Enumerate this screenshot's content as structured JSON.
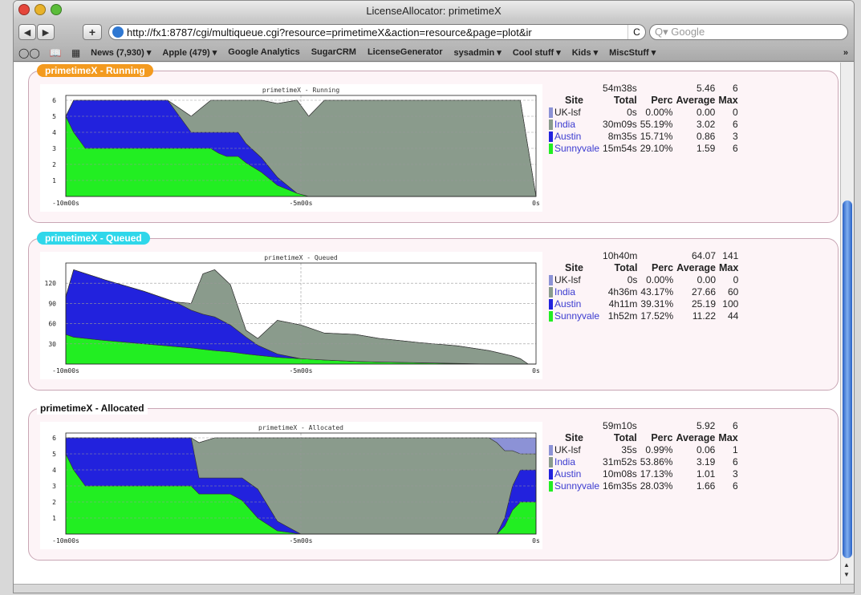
{
  "window": {
    "title": "LicenseAllocator: primetimeX"
  },
  "toolbar": {
    "back": "◀",
    "forward": "▶",
    "add": "+",
    "url": "http://fx1:8787/cgi/multiqueue.cgi?resource=primetimeX&action=resource&page=plot&ir",
    "reload": "C",
    "search_placeholder": "Q▾ Google"
  },
  "bookmarks": [
    {
      "label": "News (7,930) ▾"
    },
    {
      "label": "Apple (479) ▾"
    },
    {
      "label": "Google Analytics"
    },
    {
      "label": "SugarCRM"
    },
    {
      "label": "LicenseGenerator"
    },
    {
      "label": "sysadmin ▾"
    },
    {
      "label": "Cool stuff ▾"
    },
    {
      "label": "Kids ▾"
    },
    {
      "label": "MiscStuff ▾"
    }
  ],
  "bookmarks_overflow": "»",
  "colors": {
    "uk": "#8c92d6",
    "india": "#8a9b8c",
    "austin": "#2222dd",
    "sunnyvale": "#22ee22",
    "running": "#f39a1f",
    "queued": "#2fd7ea"
  },
  "stat_headers": {
    "site": "Site",
    "total": "Total",
    "perc": "Perc",
    "average": "Average",
    "max": "Max"
  },
  "sections": [
    {
      "legend": "primetimeX - Running",
      "summary": {
        "total": "54m38s",
        "average": "5.46",
        "max": "6"
      },
      "rows": [
        {
          "site": "UK-lsf",
          "total": "0s",
          "perc": "0.00%",
          "average": "0.00",
          "max": "0"
        },
        {
          "site": "India",
          "total": "30m09s",
          "perc": "55.19%",
          "average": "3.02",
          "max": "6"
        },
        {
          "site": "Austin",
          "total": "8m35s",
          "perc": "15.71%",
          "average": "0.86",
          "max": "3"
        },
        {
          "site": "Sunnyvale",
          "total": "15m54s",
          "perc": "29.10%",
          "average": "1.59",
          "max": "6"
        }
      ]
    },
    {
      "legend": "primetimeX - Queued",
      "summary": {
        "total": "10h40m",
        "average": "64.07",
        "max": "141"
      },
      "rows": [
        {
          "site": "UK-lsf",
          "total": "0s",
          "perc": "0.00%",
          "average": "0.00",
          "max": "0"
        },
        {
          "site": "India",
          "total": "4h36m",
          "perc": "43.17%",
          "average": "27.66",
          "max": "60"
        },
        {
          "site": "Austin",
          "total": "4h11m",
          "perc": "39.31%",
          "average": "25.19",
          "max": "100"
        },
        {
          "site": "Sunnyvale",
          "total": "1h52m",
          "perc": "17.52%",
          "average": "11.22",
          "max": "44"
        }
      ]
    },
    {
      "legend": "primetimeX - Allocated",
      "summary": {
        "total": "59m10s",
        "average": "5.92",
        "max": "6"
      },
      "rows": [
        {
          "site": "UK-lsf",
          "total": "35s",
          "perc": "0.99%",
          "average": "0.06",
          "max": "1"
        },
        {
          "site": "India",
          "total": "31m52s",
          "perc": "53.86%",
          "average": "3.19",
          "max": "6"
        },
        {
          "site": "Austin",
          "total": "10m08s",
          "perc": "17.13%",
          "average": "1.01",
          "max": "3"
        },
        {
          "site": "Sunnyvale",
          "total": "16m35s",
          "perc": "28.03%",
          "average": "1.66",
          "max": "6"
        }
      ]
    }
  ],
  "chart_data": [
    {
      "type": "area",
      "title": "primetimeX - Running",
      "x": [
        -600,
        -590,
        -575,
        -545,
        -525,
        -500,
        -470,
        -440,
        -415,
        -405,
        -395,
        -380,
        -370,
        -350,
        -330,
        -305,
        -290,
        -270,
        -250,
        -230,
        -200,
        -150,
        -100,
        -70,
        -50,
        -40,
        -30,
        -20,
        -10,
        0
      ],
      "xticks": [
        "-10m00s",
        "-5m00s",
        "0s"
      ],
      "yticks": [
        1,
        2,
        3,
        4,
        5,
        6
      ],
      "ylim": [
        0,
        6.3
      ],
      "series": [
        {
          "name": "Sunnyvale",
          "values": [
            5,
            4,
            3,
            3,
            3,
            3,
            3,
            3,
            3,
            2.7,
            2.5,
            2.5,
            2.1,
            1.5,
            0.7,
            0.2,
            0,
            0,
            0,
            0,
            0,
            0,
            0,
            0,
            0,
            0,
            0,
            0,
            0,
            0
          ]
        },
        {
          "name": "Austin",
          "values": [
            0,
            2,
            3,
            3,
            3,
            3,
            3,
            1,
            1,
            1.3,
            1.5,
            1.5,
            1.2,
            0.9,
            0.5,
            0,
            0,
            0,
            0,
            0,
            0,
            0,
            0,
            0,
            0,
            0,
            0,
            0,
            0,
            0
          ]
        },
        {
          "name": "India",
          "values": [
            0,
            0,
            0,
            0,
            0,
            0,
            0,
            1,
            2,
            2,
            2,
            2,
            2.7,
            3.6,
            4.6,
            5.8,
            5,
            6,
            6,
            6,
            6,
            6,
            6,
            6,
            6,
            6,
            6,
            6,
            3,
            0
          ]
        },
        {
          "name": "UK-lsf",
          "values": [
            0,
            0,
            0,
            0,
            0,
            0,
            0,
            0,
            0,
            0,
            0,
            0,
            0,
            0,
            0,
            0,
            0,
            0,
            0,
            0,
            0,
            0,
            0,
            0,
            0,
            0,
            0,
            0,
            0,
            0
          ]
        }
      ]
    },
    {
      "type": "area",
      "title": "primetimeX - Queued",
      "x": [
        -600,
        -590,
        -550,
        -500,
        -460,
        -440,
        -425,
        -410,
        -390,
        -370,
        -355,
        -330,
        -300,
        -270,
        -230,
        -200,
        -150,
        -100,
        -60,
        -30,
        -20,
        -10,
        0
      ],
      "xticks": [
        "-10m00s",
        "-5m00s",
        "0s"
      ],
      "yticks": [
        30,
        60,
        90,
        120
      ],
      "ylim": [
        0,
        150
      ],
      "series": [
        {
          "name": "Sunnyvale",
          "values": [
            44,
            40,
            35,
            30,
            26,
            24,
            22,
            20,
            18,
            15,
            13,
            10,
            8,
            6,
            4,
            3,
            2,
            1,
            0,
            0,
            0,
            0,
            0
          ]
        },
        {
          "name": "Austin",
          "values": [
            56,
            100,
            90,
            78,
            66,
            56,
            52,
            50,
            40,
            25,
            15,
            5,
            0,
            0,
            0,
            0,
            0,
            0,
            0,
            0,
            0,
            0,
            0
          ]
        },
        {
          "name": "India",
          "values": [
            0,
            0,
            0,
            0,
            0,
            10,
            60,
            70,
            60,
            10,
            10,
            50,
            50,
            40,
            40,
            35,
            30,
            26,
            20,
            12,
            8,
            0,
            0
          ]
        },
        {
          "name": "UK-lsf",
          "values": [
            0,
            0,
            0,
            0,
            0,
            0,
            0,
            0,
            0,
            0,
            0,
            0,
            0,
            0,
            0,
            0,
            0,
            0,
            0,
            0,
            0,
            0,
            0
          ]
        }
      ]
    },
    {
      "type": "area",
      "title": "primetimeX - Allocated",
      "x": [
        -600,
        -590,
        -575,
        -545,
        -520,
        -470,
        -440,
        -430,
        -410,
        -390,
        -375,
        -355,
        -330,
        -300,
        -250,
        -150,
        -80,
        -60,
        -50,
        -40,
        -30,
        -20,
        0
      ],
      "xticks": [
        "-10m00s",
        "-5m00s",
        "0s"
      ],
      "yticks": [
        1,
        2,
        3,
        4,
        5,
        6
      ],
      "ylim": [
        0,
        6.3
      ],
      "series": [
        {
          "name": "Sunnyvale",
          "values": [
            5,
            4,
            3,
            3,
            3,
            3,
            3,
            2.5,
            2.5,
            2.5,
            2.1,
            1,
            0.2,
            0,
            0,
            0,
            0,
            0,
            0,
            0.5,
            1.5,
            2,
            2
          ]
        },
        {
          "name": "Austin",
          "values": [
            1,
            2,
            3,
            3,
            3,
            3,
            3,
            1,
            1,
            1,
            1.4,
            1.8,
            0.6,
            0,
            0,
            0,
            0,
            0,
            0,
            0.5,
            1.5,
            2,
            2
          ]
        },
        {
          "name": "India",
          "values": [
            0,
            0,
            0,
            0,
            0,
            0,
            0,
            2.2,
            2.5,
            2.5,
            2.5,
            3.2,
            5.2,
            6,
            6,
            6,
            6,
            6,
            5.7,
            4.2,
            2.2,
            1,
            1
          ]
        },
        {
          "name": "UK-lsf",
          "values": [
            0,
            0,
            0,
            0,
            0,
            0,
            0,
            0,
            0,
            0,
            0,
            0,
            0,
            0,
            0,
            0,
            0,
            0,
            0.3,
            0.8,
            0.8,
            1,
            1
          ]
        }
      ]
    }
  ]
}
